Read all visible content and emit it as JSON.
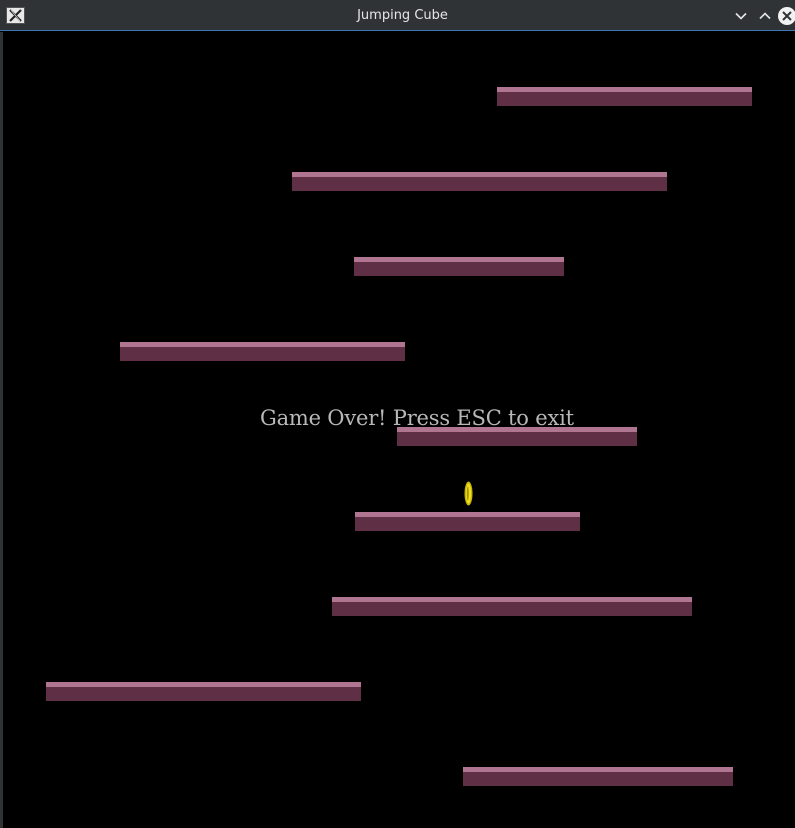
{
  "window": {
    "title": "Jumping Cube",
    "app_icon": "x11-app-icon",
    "controls": [
      "minimize",
      "maximize",
      "close"
    ],
    "accent_color": "#3d7ab3"
  },
  "game": {
    "message": "Game Over! Press ESC to exit",
    "background_color": "#000000",
    "platform_colors": {
      "top": "#b07590",
      "body": "#5e2f45"
    },
    "coin_color": "#e8d81a",
    "platform_count": 9,
    "coin_count": 1
  }
}
